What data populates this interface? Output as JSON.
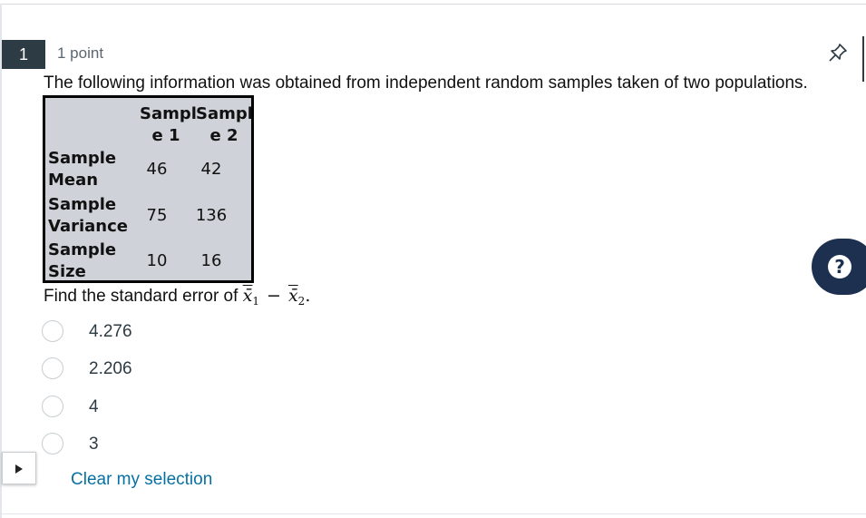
{
  "question": {
    "number": "1",
    "points": "1 point",
    "prompt": "The following information was obtained from independent random samples taken of two populations.",
    "ask_prefix": "Find the standard error of ",
    "ask_math": {
      "x1": "x̄",
      "sub1": "1",
      "minus": "−",
      "x2": "x̄",
      "sub2": "2",
      "period": "."
    }
  },
  "table": {
    "headers": [
      [
        "Sampl",
        "e 1"
      ],
      [
        "Sampl",
        "e 2"
      ]
    ],
    "rows": [
      {
        "label": [
          "Sample",
          "Mean"
        ],
        "values": [
          "46",
          "42"
        ]
      },
      {
        "label": [
          "Sample",
          "Variance"
        ],
        "values": [
          "75",
          "136"
        ]
      },
      {
        "label": [
          "Sample",
          "Size"
        ],
        "values": [
          "10",
          "16"
        ]
      }
    ]
  },
  "options": [
    "4.276",
    "2.206",
    "4",
    "3"
  ],
  "clear_label": "Clear my selection",
  "help_label": "?",
  "icons": {
    "pin": "pin-icon",
    "help": "help-icon",
    "toggle": "triangle-right-icon"
  },
  "colors": {
    "number_badge": "#2d3b45",
    "link": "#0770a3",
    "help_bg": "#1d3050",
    "table_bg": "#cfd3d9"
  }
}
